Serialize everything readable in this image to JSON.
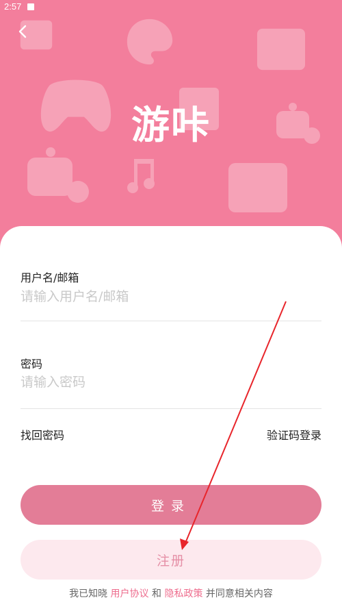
{
  "status_bar": {
    "time": "2:57"
  },
  "header": {
    "app_title": "游咔"
  },
  "form": {
    "username_label": "用户名/邮箱",
    "username_placeholder": "请输入用户名/邮箱",
    "password_label": "密码",
    "password_placeholder": "请输入密码",
    "forgot_password": "找回密码",
    "code_login": "验证码登录",
    "login_button": "登录",
    "register_button": "注册"
  },
  "agreement": {
    "prefix": "我已知晓",
    "user_agreement": "用户协议",
    "and": "和",
    "privacy_policy": "隐私政策",
    "suffix": "并同意相关内容"
  },
  "colors": {
    "brand_pink": "#f37e9c",
    "login_button": "#e37d97",
    "register_button_bg": "#fde9ee",
    "link_pink": "#ee6d8e",
    "annotation_arrow": "#e8252b"
  }
}
